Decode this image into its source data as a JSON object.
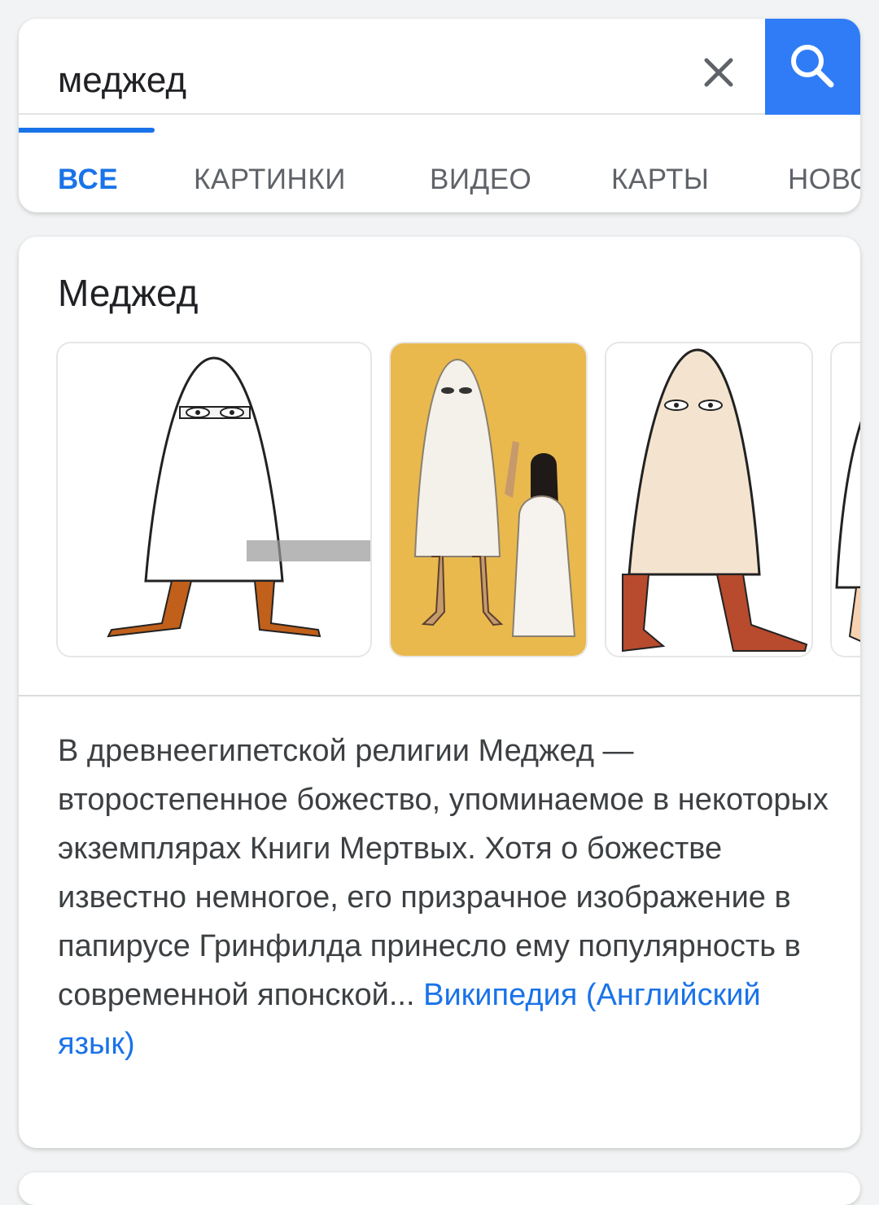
{
  "search": {
    "query": "меджед",
    "clear_icon": "close-icon",
    "search_icon": "search-icon"
  },
  "tabs": [
    {
      "label": "ВСЕ",
      "active": true
    },
    {
      "label": "КАРТИНКИ",
      "active": false
    },
    {
      "label": "ВИДЕО",
      "active": false
    },
    {
      "label": "КАРТЫ",
      "active": false
    },
    {
      "label": "НОВО",
      "active": false
    }
  ],
  "knowledge_panel": {
    "title": "Меджед",
    "description": "В древнеегипетской религии Меджед — второстепенное божество, упоминаемое в некоторых экземплярах Книги Мертвых. Хотя о божестве известно немногое, его призрачное изображение в папирусе Гринфилда принесло ему популярность в современной японской... ",
    "source_link": "Википедия (Английский язык)"
  },
  "colors": {
    "accent": "#1a73e8",
    "search_button": "#2f7cf6"
  }
}
